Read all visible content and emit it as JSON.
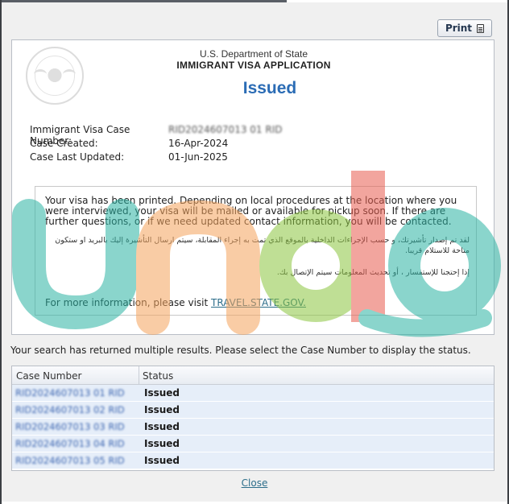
{
  "header": {
    "department": "U.S. Department of State",
    "application": "IMMIGRANT VISA APPLICATION",
    "status": "Issued"
  },
  "toolbar": {
    "print_label": "Print"
  },
  "case_info": {
    "case_number_label": "Immigrant Visa Case Number:",
    "case_number_value": "RID2024607013 01 RID",
    "created_label": "Case Created:",
    "created_value": "16-Apr-2024",
    "updated_label": "Case Last Updated:",
    "updated_value": "01-Jun-2025"
  },
  "message": {
    "english": "Your visa has been printed. Depending on local procedures at the location where you were interviewed, your visa will be mailed or available for pickup soon. If there are further questions, or if we need updated contact information, you will be contacted.",
    "arabic_1": "لقد تم إصدار تأشيرتك، و حسب الإجراءات الداخلية بالموقع الذي تمت به إجراء المقابلة، سيتم ارسال التأشيرة إليك بالبريد او ستكون متاحة للاستلام قريبا.",
    "arabic_2": "إذا إحتجنا للإستفسار ، أو تحديث المعلومات سيتم الإتصال بك.",
    "more_info_prefix": "For more information, please visit ",
    "more_info_link": "TRAVEL.STATE.GOV."
  },
  "search_message": "Your search has returned multiple results. Please select the Case Number to display the status.",
  "results": {
    "headers": {
      "case_number": "Case Number",
      "status": "Status"
    },
    "rows": [
      {
        "case_number": "RID2024607013 01 RID",
        "status": "Issued"
      },
      {
        "case_number": "RID2024607013 02 RID",
        "status": "Issued"
      },
      {
        "case_number": "RID2024607013 03 RID",
        "status": "Issued"
      },
      {
        "case_number": "RID2024607013 04 RID",
        "status": "Issued"
      },
      {
        "case_number": "RID2024607013 05 RID",
        "status": "Issued"
      }
    ]
  },
  "footer": {
    "close_label": "Close"
  },
  "watermark": {
    "text": "unodo",
    "colors": [
      "#2bb3a3",
      "#f5a45d",
      "#8cc63f",
      "#e85d4f"
    ]
  },
  "colors": {
    "status_blue": "#2b6cb5",
    "link_teal": "#2c6d8a",
    "row_bg": "#e6eef9"
  }
}
